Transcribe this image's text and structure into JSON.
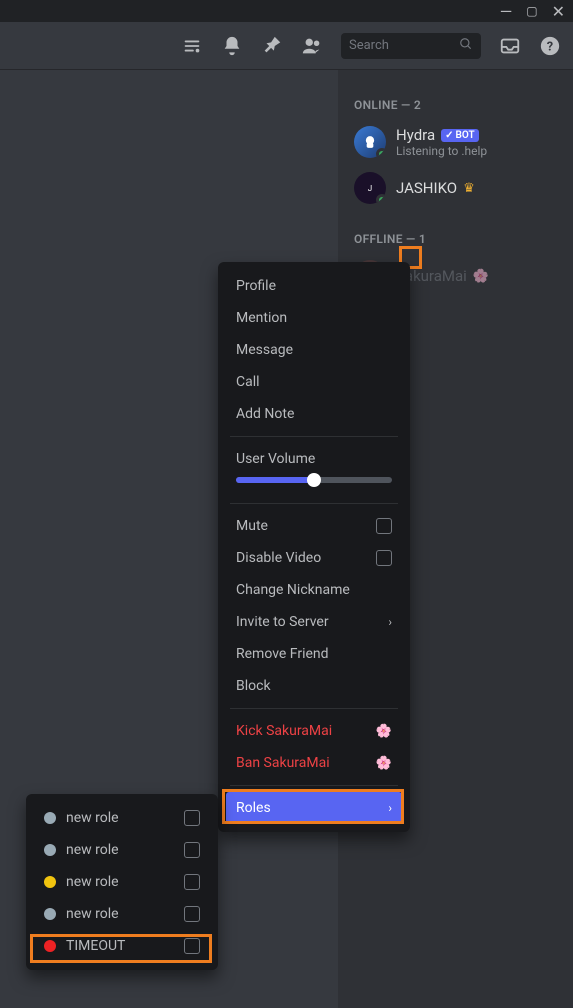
{
  "search": {
    "placeholder": "Search"
  },
  "members": {
    "online_header": "ONLINE — 2",
    "offline_header": "OFFLINE — 1",
    "hydra": {
      "name": "Hydra",
      "bot_tag": "BOT",
      "activity": "Listening to .help"
    },
    "jashiko": {
      "name": "JASHIKO"
    },
    "sakuramai": {
      "name": "SakuraMai"
    }
  },
  "context_menu": {
    "profile": "Profile",
    "mention": "Mention",
    "message": "Message",
    "call": "Call",
    "add_note": "Add Note",
    "user_volume": "User Volume",
    "volume_percent": 50,
    "mute": "Mute",
    "disable_video": "Disable Video",
    "change_nickname": "Change Nickname",
    "invite_to_server": "Invite to Server",
    "remove_friend": "Remove Friend",
    "block": "Block",
    "kick": "Kick SakuraMai",
    "ban": "Ban SakuraMai",
    "roles": "Roles"
  },
  "roles_submenu": {
    "items": [
      {
        "label": "new role",
        "color": "#99aab5"
      },
      {
        "label": "new role",
        "color": "#99aab5"
      },
      {
        "label": "new role",
        "color": "#f1c40f"
      },
      {
        "label": "new role",
        "color": "#99aab5"
      },
      {
        "label": "TIMEOUT",
        "color": "#ed2224"
      }
    ]
  }
}
